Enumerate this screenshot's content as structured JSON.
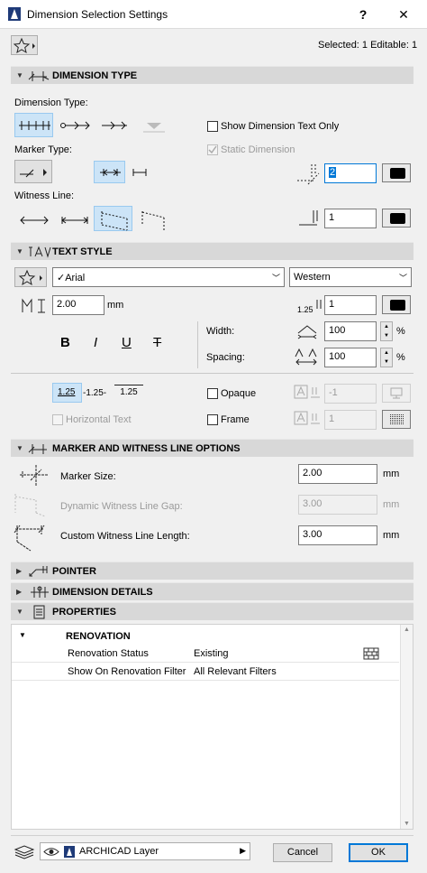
{
  "window": {
    "title": "Dimension Selection Settings",
    "help": "?",
    "close": "✕"
  },
  "header": {
    "selected": "Selected: 1 Editable: 1"
  },
  "sections": {
    "dimension_type": "DIMENSION TYPE",
    "text_style": "TEXT STYLE",
    "marker_witness": "MARKER AND WITNESS LINE OPTIONS",
    "pointer": "POINTER",
    "dimension_details": "DIMENSION DETAILS",
    "properties": "PROPERTIES"
  },
  "dimension_type": {
    "dimension_type_label": "Dimension Type:",
    "show_text_only": "Show Dimension Text Only",
    "marker_type_label": "Marker Type:",
    "static_dimension": "Static Dimension",
    "marker_pen": "2",
    "witness_line_label": "Witness Line:",
    "witness_pen": "1"
  },
  "text_style": {
    "font": "✓Arial",
    "script": "Western",
    "size": "2.00",
    "unit": "mm",
    "text_pen": "1",
    "width_label": "Width:",
    "width_value": "100",
    "spacing_label": "Spacing:",
    "spacing_value": "100",
    "percent": "%",
    "bold": "B",
    "italic": "I",
    "underline": "U",
    "strike": "T",
    "pos_sample_1": "1.25",
    "pos_sample_2": "-1.25-",
    "pos_sample_3": "1.25",
    "opaque": "Opaque",
    "opaque_value": "-1",
    "horizontal_text": "Horizontal Text",
    "frame": "Frame",
    "frame_value": "1"
  },
  "marker_options": {
    "marker_size_label": "Marker Size:",
    "marker_size": "2.00",
    "gap_label": "Dynamic Witness Line Gap:",
    "gap": "3.00",
    "custom_len_label": "Custom Witness Line Length:",
    "custom_len": "3.00",
    "unit": "mm"
  },
  "properties": {
    "group": "RENOVATION",
    "rows": [
      {
        "name": "Renovation Status",
        "value": "Existing"
      },
      {
        "name": "Show On Renovation Filter",
        "value": "All Relevant Filters"
      }
    ]
  },
  "footer": {
    "layer": "ARCHICAD Layer",
    "cancel": "Cancel",
    "ok": "OK"
  }
}
